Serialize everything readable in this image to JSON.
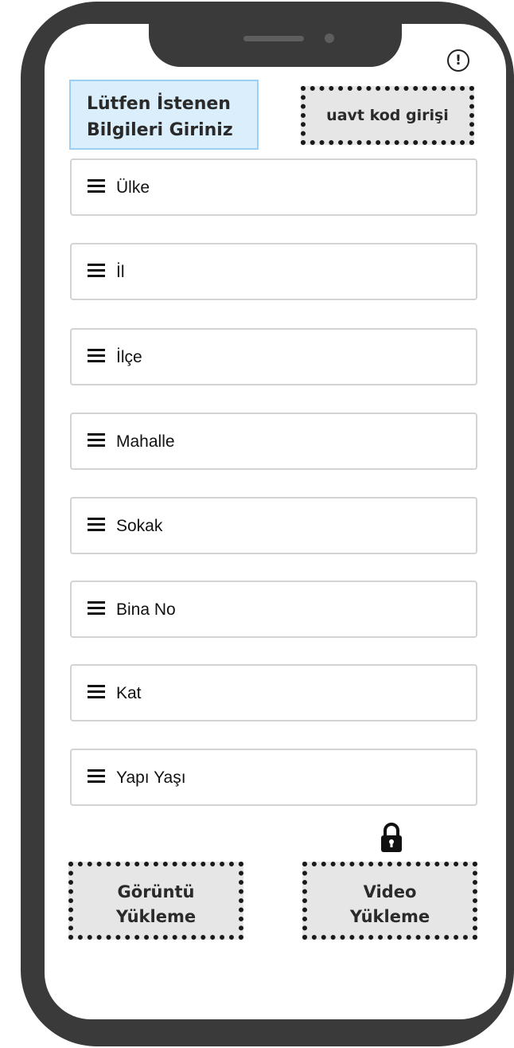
{
  "header": {
    "title_line1": "Lütfen İstenen",
    "title_line2": "Bilgileri Giriniz",
    "uavt_button_label": "uavt kod girişi",
    "info_icon": "info-circle-icon",
    "info_glyph": "!"
  },
  "form": {
    "fields": [
      {
        "label": "Ülke",
        "icon": "menu-icon"
      },
      {
        "label": "İl",
        "icon": "menu-icon"
      },
      {
        "label": "İlçe",
        "icon": "menu-icon"
      },
      {
        "label": "Mahalle",
        "icon": "menu-icon"
      },
      {
        "label": "Sokak",
        "icon": "menu-icon"
      },
      {
        "label": "Bina No",
        "icon": "menu-icon"
      },
      {
        "label": "Kat",
        "icon": "menu-icon"
      },
      {
        "label": "Yapı Yaşı",
        "icon": "menu-icon"
      }
    ]
  },
  "footer": {
    "image_upload_line1": "Görüntü",
    "image_upload_line2": "Yükleme",
    "video_upload_line1": "Video",
    "video_upload_line2": "Yükleme",
    "video_locked_icon": "lock-icon"
  },
  "colors": {
    "frame": "#3a3a3a",
    "title_background": "#daeefb",
    "title_border": "#9cd0f3",
    "button_background": "#e6e6e6",
    "field_border": "#d3d3d3"
  }
}
